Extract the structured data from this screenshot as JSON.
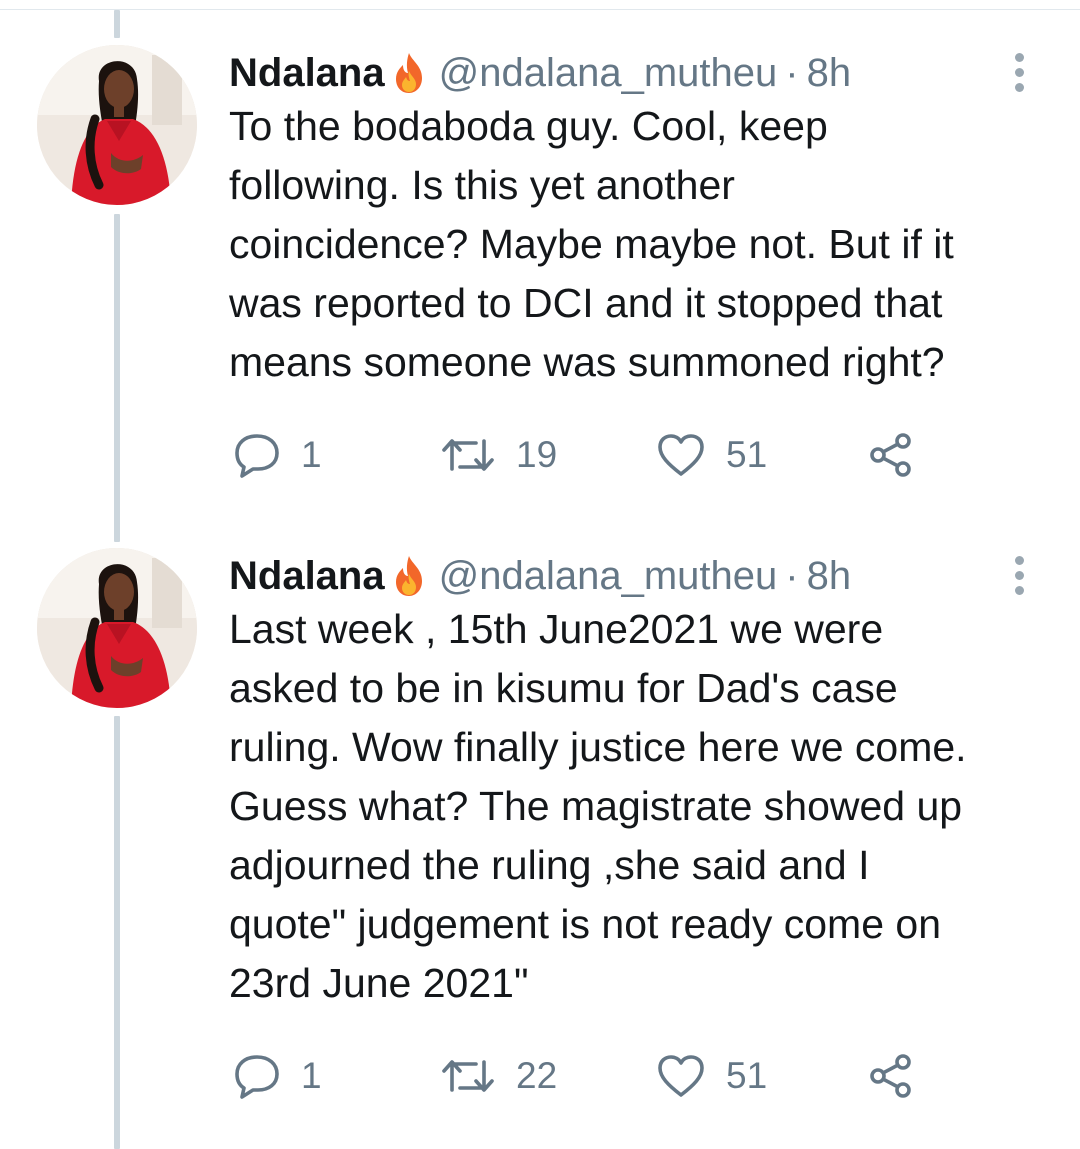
{
  "tweets": [
    {
      "author_name": "Ndalana",
      "handle": "@ndalana_mutheu",
      "separator": "·",
      "time": "8h",
      "text": "To the bodaboda guy. Cool, keep\nfollowing. Is this yet another\ncoincidence? Maybe maybe not. But if it\nwas reported to DCI and it stopped that\nmeans someone was summoned right?",
      "replies": "1",
      "retweets": "19",
      "likes": "51"
    },
    {
      "author_name": "Ndalana",
      "handle": "@ndalana_mutheu",
      "separator": "·",
      "time": "8h",
      "text": "Last week , 15th June2021 we were\nasked to be in kisumu for Dad's case\nruling. Wow finally justice here we come.\nGuess what? The magistrate showed up\nadjourned the ruling ,she said and I\nquote\" judgement is not ready come on\n23rd June 2021\"",
      "replies": "1",
      "retweets": "22",
      "likes": "51"
    }
  ],
  "icons": {
    "name_emoji": "fire-icon",
    "more": "more-vertical-icon",
    "reply": "reply-icon",
    "retweet": "retweet-icon",
    "like": "heart-icon",
    "share": "share-icon"
  },
  "colors": {
    "text": "#14171a",
    "secondary": "#657786",
    "thread_line": "#ccd6dd",
    "avatar_dress": "#d8192a"
  }
}
